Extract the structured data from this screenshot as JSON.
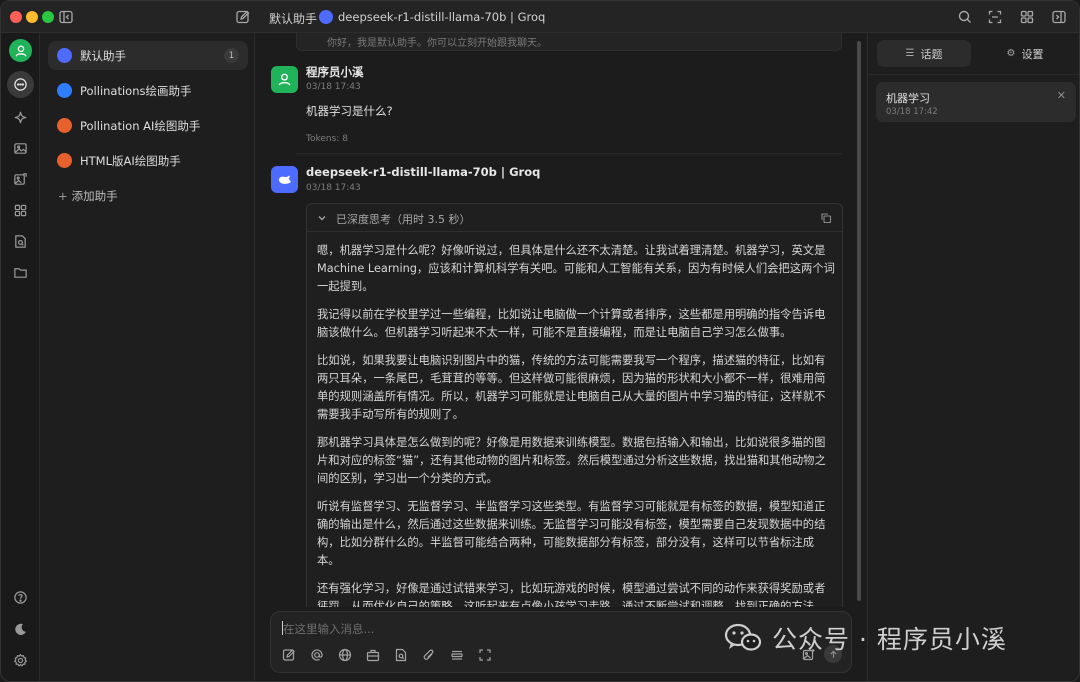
{
  "titlebar": {
    "assistant_name": "默认助手",
    "model_name": "deepseek-r1-distill-llama-70b | Groq"
  },
  "rail": {
    "items": [
      "avatar-icon",
      "chat-icon",
      "sparkle-icon",
      "image-icon",
      "image-edit-icon",
      "apps-icon",
      "doc-search-icon",
      "folder-icon",
      "help-icon",
      "moon-icon",
      "settings-icon"
    ]
  },
  "assistants": {
    "items": [
      {
        "label": "默认助手",
        "count": "1",
        "logo_color": "#4d6bfe"
      },
      {
        "label": "Pollinations绘画助手",
        "logo_color": "#2f7dff"
      },
      {
        "label": "Pollination AI绘图助手",
        "logo_color": "#e8612c"
      },
      {
        "label": "HTML版AI绘图助手",
        "logo_color": "#e8612c"
      }
    ],
    "add_label": "添加助手"
  },
  "chat": {
    "greeting": "你好，我是默认助手。你可以立刻开始跟我聊天。",
    "user_msg": {
      "name": "程序员小溪",
      "time": "03/18 17:43",
      "text": "机器学习是什么?",
      "tokens": "Tokens: 8"
    },
    "ai_msg": {
      "name": "deepseek-r1-distill-llama-70b | Groq",
      "time": "03/18 17:43",
      "think_title": "已深度思考（用时 3.5 秒）",
      "paragraphs": [
        "嗯，机器学习是什么呢？好像听说过，但具体是什么还不太清楚。让我试着理清楚。机器学习，英文是Machine Learning，应该和计算机科学有关吧。可能和人工智能有关系，因为有时候人们会把这两个词一起提到。",
        "我记得以前在学校里学过一些编程，比如说让电脑做一个计算或者排序，这些都是用明确的指令告诉电脑该做什么。但机器学习听起来不太一样，可能不是直接编程，而是让电脑自己学习怎么做事。",
        "比如说，如果我要让电脑识别图片中的猫，传统的方法可能需要我写一个程序，描述猫的特征，比如有两只耳朵，一条尾巴，毛茸茸的等等。但这样做可能很麻烦，因为猫的形状和大小都不一样，很难用简单的规则涵盖所有情况。所以，机器学习可能就是让电脑自己从大量的图片中学习猫的特征，这样就不需要我手动写所有的规则了。",
        "那机器学习具体是怎么做到的呢？好像是用数据来训练模型。数据包括输入和输出，比如说很多猫的图片和对应的标签“猫”，还有其他动物的图片和标签。然后模型通过分析这些数据，找出猫和其他动物之间的区别，学习出一个分类的方式。",
        "听说有监督学习、无监督学习、半监督学习这些类型。有监督学习可能就是有标签的数据，模型知道正确的输出是什么，然后通过这些数据来训练。无监督学习可能没有标签，模型需要自己发现数据中的结构，比如分群什么的。半监督可能结合两种，可能数据部分有标签，部分没有，这样可以节省标注成本。",
        "还有强化学习，好像是通过试错来学习，比如玩游戏的时候，模型通过尝试不同的动作来获得奖励或者惩罚，从而优化自己的策略。这听起来有点像小孩学习走路，通过不断尝试和调整，找到正确的方法。"
      ]
    },
    "input_placeholder": "在这里输入消息...",
    "tools": [
      "edit-icon",
      "at-icon",
      "globe-icon",
      "toolbox-icon",
      "doc-search-icon",
      "attach-icon",
      "list-icon",
      "expand-icon",
      "image-add-icon"
    ]
  },
  "right_panel": {
    "tab_topics": "话题",
    "tab_settings": "设置",
    "topic": {
      "title": "机器学习",
      "time": "03/18 17:42"
    }
  },
  "watermark": {
    "text": "公众号 · 程序员小溪"
  }
}
